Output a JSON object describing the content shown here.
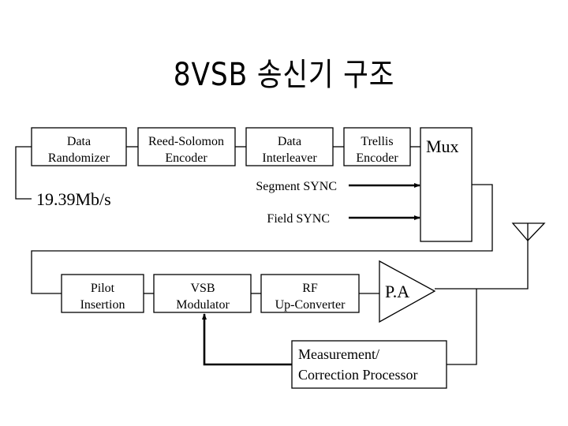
{
  "title": "8VSB 송신기 구조",
  "input_rate": "19.39Mb/s",
  "blocks": {
    "randomizer": [
      "Data",
      "Randomizer"
    ],
    "reed_solomon": [
      "Reed-Solomon",
      "Encoder"
    ],
    "interleaver": [
      "Data",
      "Interleaver"
    ],
    "trellis": [
      "Trellis",
      "Encoder"
    ],
    "mux": "Mux",
    "pilot": [
      "Pilot",
      "Insertion"
    ],
    "vsb_mod": [
      "VSB",
      "Modulator"
    ],
    "rf_up": [
      "RF",
      "Up-Converter"
    ],
    "pa": "P.A",
    "measurement": [
      "Measurement/",
      "Correction Processor"
    ]
  },
  "signals": {
    "segment_sync": "Segment SYNC",
    "field_sync": "Field SYNC"
  }
}
